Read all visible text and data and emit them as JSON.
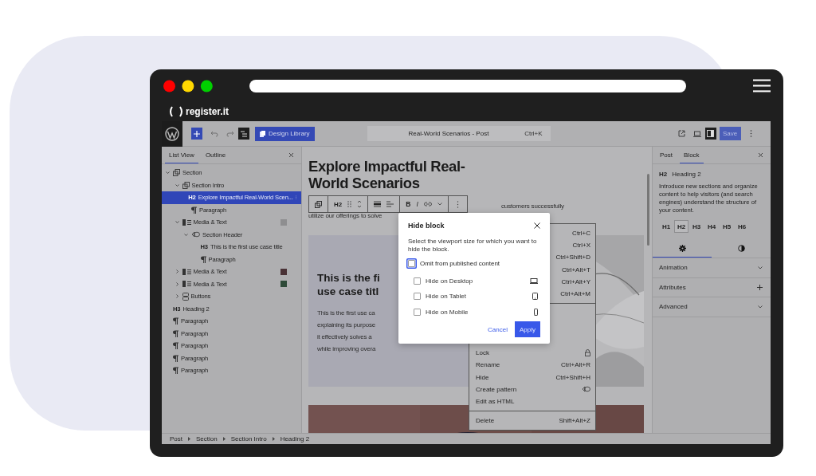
{
  "brand": "register.it",
  "toolbar": {
    "design_library": "Design Library",
    "document_title": "Real-World Scenarios - Post",
    "shortcut": "Ctrl+K",
    "save": "Save",
    "save_disabled": true,
    "list_view_open": true,
    "sidebar_open": true
  },
  "list_view": {
    "tabs": [
      {
        "label": "List View",
        "selected": true
      },
      {
        "label": "Outline",
        "selected": false
      }
    ],
    "items": [
      {
        "kind": "group",
        "label": "Section",
        "selected": false,
        "expanded": true,
        "children": [
          {
            "kind": "group",
            "label": "Section Intro",
            "selected": false,
            "expanded": true,
            "children": [
              {
                "kind": "heading",
                "tag": "H2",
                "label": "Explore Impactful Real-World Scen...",
                "selected": true
              },
              {
                "kind": "paragraph",
                "label": "Paragraph",
                "selected": false
              }
            ]
          },
          {
            "kind": "media-text",
            "label": "Media & Text",
            "selected": false,
            "expanded": true,
            "color": "#8e8e90",
            "children": [
              {
                "kind": "header",
                "label": "Section Header",
                "selected": false,
                "expanded": true,
                "children": [
                  {
                    "kind": "heading",
                    "tag": "H3",
                    "label": "This is the first use case title",
                    "selected": false
                  },
                  {
                    "kind": "paragraph",
                    "label": "Paragraph",
                    "selected": false
                  }
                ]
              }
            ]
          },
          {
            "kind": "media-text",
            "label": "Media & Text",
            "selected": false,
            "expanded": false,
            "color": "#4a3236"
          },
          {
            "kind": "media-text",
            "label": "Media & Text",
            "selected": false,
            "expanded": false,
            "color": "#2e4a38"
          },
          {
            "kind": "buttons",
            "label": "Buttons",
            "selected": false,
            "expanded": false
          }
        ]
      },
      {
        "kind": "heading",
        "tag": "H3",
        "label": "Heading 2",
        "selected": false
      },
      {
        "kind": "paragraph",
        "label": "Paragraph",
        "selected": false
      },
      {
        "kind": "paragraph",
        "label": "Paragraph",
        "selected": false
      },
      {
        "kind": "paragraph",
        "label": "Paragraph",
        "selected": false
      },
      {
        "kind": "paragraph",
        "label": "Paragraph",
        "selected": false
      },
      {
        "kind": "paragraph",
        "label": "Paragraph",
        "selected": false
      }
    ]
  },
  "canvas": {
    "title": "Explore Impactful Real-World Scenarios",
    "block_toolbar": {
      "level": "H2",
      "bold": "B",
      "italic": "I"
    },
    "intro_lines": [
      "customers successfully",
      "utilize our offerings to solve"
    ],
    "card": {
      "title_lines": [
        "This is the fi",
        "use case titl"
      ],
      "body_lines": [
        "This is the first use ca",
        "explaining its purpose",
        "it effectively solves a",
        "while improving overa"
      ]
    }
  },
  "context_menu": {
    "groups": [
      [
        {
          "shortcut": "Ctrl+C"
        },
        {
          "shortcut": "Ctrl+X"
        },
        {
          "shortcut": "Ctrl+Shift+D"
        },
        {
          "shortcut": "Ctrl+Alt+T"
        },
        {
          "shortcut": "Ctrl+Alt+Y"
        },
        {
          "shortcut": "Ctrl+Alt+M"
        }
      ],
      [
        {
          "label": "Lock",
          "kind": "lock"
        },
        {
          "label": "Rename",
          "shortcut": "Ctrl+Alt+R"
        },
        {
          "label": "Hide",
          "shortcut": "Ctrl+Shift+H"
        },
        {
          "label": "Create pattern",
          "kind": "pattern"
        },
        {
          "label": "Edit as HTML"
        }
      ],
      [
        {
          "label": "Delete",
          "shortcut": "Shift+Alt+Z"
        }
      ]
    ]
  },
  "modal": {
    "title": "Hide block",
    "description": "Select the viewport size for which you want to hide the block.",
    "options": [
      {
        "kind": "omit",
        "label": "Omit from published content",
        "checked": false,
        "focused": true
      },
      {
        "kind": "desktop",
        "label": "Hide on Desktop",
        "checked": false,
        "focused": false
      },
      {
        "kind": "tablet",
        "label": "Hide on Tablet",
        "checked": false,
        "focused": false
      },
      {
        "kind": "mobile",
        "label": "Hide on Mobile",
        "checked": false,
        "focused": false
      }
    ],
    "cancel": "Cancel",
    "apply": "Apply"
  },
  "sidebar": {
    "tabs": [
      {
        "label": "Post",
        "selected": false
      },
      {
        "label": "Block",
        "selected": true
      }
    ],
    "block": {
      "tag": "H2",
      "name": "Heading 2",
      "description": "Introduce new sections and organize content to help visitors (and search engines) understand the structure of your content."
    },
    "levels": [
      {
        "label": "H1",
        "selected": false
      },
      {
        "label": "H2",
        "selected": true
      },
      {
        "label": "H3",
        "selected": false
      },
      {
        "label": "H4",
        "selected": false
      },
      {
        "label": "H5",
        "selected": false
      },
      {
        "label": "H6",
        "selected": false
      }
    ],
    "setting_tabs": [
      {
        "kind": "settings",
        "selected": true
      },
      {
        "kind": "styles",
        "selected": false
      }
    ],
    "panels": [
      {
        "label": "Animation",
        "kind": "chevron"
      },
      {
        "label": "Attributes",
        "kind": "plus"
      },
      {
        "label": "Advanced",
        "kind": "chevron"
      }
    ]
  },
  "breadcrumb": [
    "Post",
    "Section",
    "Section Intro",
    "Heading 2"
  ]
}
